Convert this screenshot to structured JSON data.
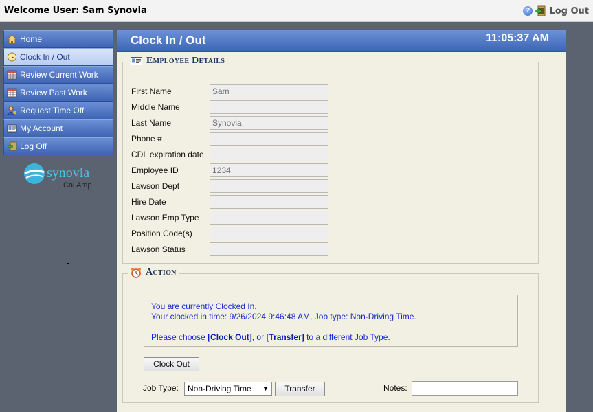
{
  "topbar": {
    "welcome": "Welcome User: Sam Synovia",
    "logout_label": "Log Out"
  },
  "sidebar": {
    "items": [
      {
        "label": "Home",
        "icon": "home-icon"
      },
      {
        "label": "Clock In / Out",
        "icon": "clock-icon",
        "active": true
      },
      {
        "label": "Review Current Work",
        "icon": "spreadsheet-icon"
      },
      {
        "label": "Review Past Work",
        "icon": "spreadsheet-icon"
      },
      {
        "label": "Request Time Off",
        "icon": "person-icon"
      },
      {
        "label": "My Account",
        "icon": "id-card-icon"
      },
      {
        "label": "Log Off",
        "icon": "exit-icon"
      }
    ],
    "logo": {
      "brand": "synovia",
      "sub": "Cal Amp"
    }
  },
  "header": {
    "title": "Clock In / Out",
    "time": "11:05:37 AM"
  },
  "employee": {
    "legend": "Employee Details",
    "fields": [
      {
        "label": "First Name",
        "value": "Sam"
      },
      {
        "label": "Middle Name",
        "value": ""
      },
      {
        "label": "Last Name",
        "value": "Synovia"
      },
      {
        "label": "Phone #",
        "value": ""
      },
      {
        "label": "CDL expiration date",
        "value": ""
      },
      {
        "label": "Employee ID",
        "value": "1234"
      },
      {
        "label": "Lawson Dept",
        "value": ""
      },
      {
        "label": "Hire Date",
        "value": ""
      },
      {
        "label": "Lawson Emp Type",
        "value": ""
      },
      {
        "label": "Position Code(s)",
        "value": ""
      },
      {
        "label": "Lawson Status",
        "value": ""
      }
    ]
  },
  "action": {
    "legend": "Action",
    "status_line1": "You are currently Clocked In.",
    "status_line2": "Your clocked in time: 9/26/2024 9:46:48 AM, Job type: Non-Driving Time.",
    "choose_prefix": "Please choose ",
    "choose_clockout": "[Clock Out]",
    "choose_mid": ", or ",
    "choose_transfer": "[Transfer]",
    "choose_suffix": " to a different Job Type.",
    "clock_out_button": "Clock Out",
    "job_type_label": "Job Type:",
    "job_type_selected": "Non-Driving Time",
    "transfer_button": "Transfer",
    "notes_label": "Notes:",
    "notes_value": ""
  },
  "colors": {
    "nav_blue": "#3e64b4",
    "content_bg": "#f1f0e2",
    "message_text": "#1a2ad0",
    "legend_text": "#1b365d"
  }
}
